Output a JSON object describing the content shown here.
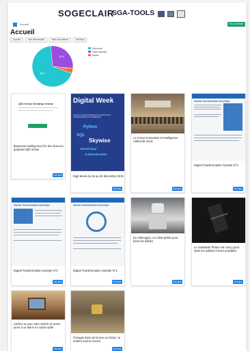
{
  "header": {
    "logo_left": "SOGECLAIR",
    "logo_right": "SGA-TOOLS"
  },
  "topbar": {
    "home_label": "Accueil",
    "connect_label": "Se connecter"
  },
  "page_title": "Accueil",
  "tabs": [
    "Accueil",
    "Vue d'ensemble",
    "Mes documents",
    "Desktop"
  ],
  "chart_data": {
    "type": "pie",
    "series": [
      {
        "name": "Réunions",
        "value": 68,
        "color": "#22c7d0"
      },
      {
        "name": "Visite internes",
        "value": 28,
        "color": "#9b4de0"
      },
      {
        "name": "Autres",
        "value": 4,
        "color": "#ff6a3c"
      }
    ],
    "slice_labels": [
      "68 %",
      "28 %",
      "4 %"
    ],
    "legend_position": "right"
  },
  "cards": [
    {
      "title": "[Business Intelligence] Fin des licences gratuites Qlik Sense",
      "thumb_heading": "Qlik Sense Desktop évolue",
      "more": "Voir plus"
    },
    {
      "title": "Digit Week du 16 au 20 décembre 2019",
      "thumb_big": "Digital Week",
      "thumb_small": "PLACE À LA DÉCOUVERTE DE SERVICES ET TRANSFORMATION NUMÉRIQUE",
      "thumb_words": [
        "Python",
        "SQL",
        "Skywise",
        "Numérique",
        "Automatisation"
      ],
      "more": "Voir plus"
    },
    {
      "title": "Le Forum Innovation et Intelligence Artificielle 2019",
      "more": "Voir plus"
    },
    {
      "title": "Digital Transformation Gazette N°3",
      "thumb_heading": "Gazette Transformation numérique",
      "more": "Voir plus"
    },
    {
      "title": "Digital Transformation Gazette N°2",
      "thumb_heading": "Gazette Transformation numérique",
      "more": "Voir plus"
    },
    {
      "title": "Digital Transformation Gazette N°1",
      "thumb_heading": "Gazette Transformation numérique",
      "more": "Voir plus"
    },
    {
      "title": "En Allemagne, un robot-prêtre pour bénir les fidèles",
      "more": "Voir plus"
    },
    {
      "title": "Le Substitute Phone est conçu pour aider les addicts à leurs portables",
      "thumb_heading": "SUBSTITUTE PHONE",
      "more": "Voir plus"
    },
    {
      "title": "Lâchez un peu votre Switch et venez jouer à ce Mario en carton-pâte",
      "more": "Voir plus"
    },
    {
      "title": "Pizzagle dans de la lave en fusion, la Galileo tourne encore",
      "more": "Voir plus"
    }
  ]
}
